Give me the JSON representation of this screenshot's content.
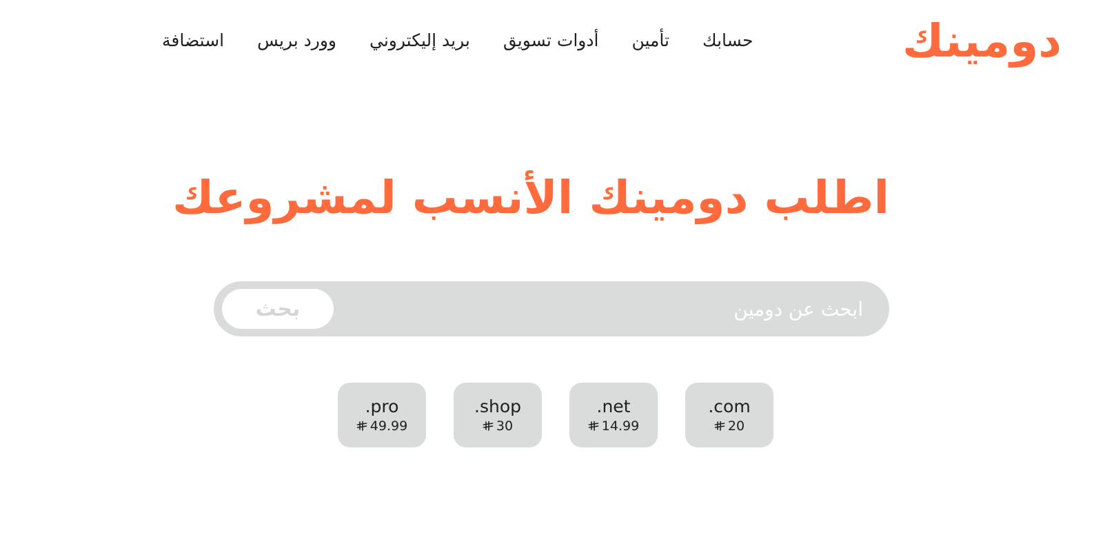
{
  "brand": {
    "logo_text": "دومينك",
    "accent_color": "#ff6b3d"
  },
  "nav": {
    "items": [
      {
        "label": "استضافة"
      },
      {
        "label": "وورد بريس"
      },
      {
        "label": "بريد إليكتروني"
      },
      {
        "label": "أدوات تسويق"
      },
      {
        "label": "تأمين"
      },
      {
        "label": "حسابك"
      }
    ]
  },
  "hero": {
    "title": "اطلب دومينك الأنسب لمشروعك"
  },
  "search": {
    "placeholder": "ابحث عن دومين",
    "button_label": "بحث"
  },
  "currency_icon": "saudi-riyal-icon",
  "tlds": [
    {
      "ext": ".pro",
      "price": "49.99"
    },
    {
      "ext": ".shop",
      "price": "30"
    },
    {
      "ext": ".net",
      "price": "14.99"
    },
    {
      "ext": ".com",
      "price": "20"
    }
  ]
}
